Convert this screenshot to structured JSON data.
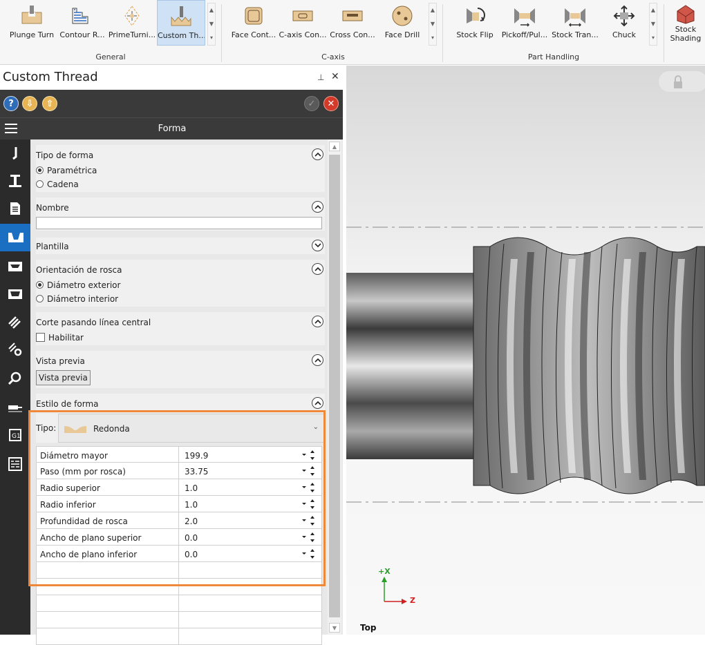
{
  "ribbon": {
    "groups": [
      {
        "label": "General",
        "buttons": [
          {
            "label": "Plunge Turn",
            "icon": "plunge-turn-icon"
          },
          {
            "label": "Contour R...",
            "icon": "contour-rough-icon"
          },
          {
            "label": "PrimeTurni...",
            "icon": "primeturning-icon"
          },
          {
            "label": "Custom Th...",
            "icon": "custom-thread-icon",
            "selected": true
          }
        ]
      },
      {
        "label": "C-axis",
        "buttons": [
          {
            "label": "Face Cont...",
            "icon": "face-contour-icon"
          },
          {
            "label": "C-axis Con...",
            "icon": "c-axis-contour-icon"
          },
          {
            "label": "Cross Con...",
            "icon": "cross-contour-icon"
          },
          {
            "label": "Face Drill",
            "icon": "face-drill-icon"
          }
        ]
      },
      {
        "label": "Part Handling",
        "buttons": [
          {
            "label": "Stock Flip",
            "icon": "stock-flip-icon"
          },
          {
            "label": "Pickoff/Pul...",
            "icon": "pickoff-pull-icon"
          },
          {
            "label": "Stock Tran...",
            "icon": "stock-transfer-icon"
          },
          {
            "label": "Chuck",
            "icon": "chuck-icon"
          }
        ]
      }
    ],
    "extra": {
      "label_line1": "Stock",
      "label_line2": "Shading"
    }
  },
  "panel": {
    "title": "Custom Thread",
    "header": "Forma",
    "sections": {
      "tipo_forma": {
        "title": "Tipo de forma",
        "options": [
          "Paramétrica",
          "Cadena"
        ],
        "selected": 0
      },
      "nombre": {
        "title": "Nombre",
        "value": ""
      },
      "plantilla": {
        "title": "Plantilla"
      },
      "orientacion": {
        "title": "Orientación de rosca",
        "options": [
          "Diámetro exterior",
          "Diámetro interior"
        ],
        "selected": 0
      },
      "corte": {
        "title": "Corte pasando línea central",
        "checkbox_label": "Habilitar",
        "checked": false
      },
      "vista": {
        "title": "Vista previa",
        "button_label": "Vista previa"
      },
      "estilo": {
        "title": "Estilo de forma"
      }
    },
    "tipo": {
      "label": "Tipo:",
      "value": "Redonda"
    },
    "params": [
      {
        "name": "Diámetro mayor",
        "value": "199.9"
      },
      {
        "name": "Paso (mm por rosca)",
        "value": "33.75"
      },
      {
        "name": "Radio superior",
        "value": "1.0"
      },
      {
        "name": "Radio inferior",
        "value": "1.0"
      },
      {
        "name": "Profundidad de rosca",
        "value": "2.0"
      },
      {
        "name": "Ancho de plano superior",
        "value": "0.0"
      },
      {
        "name": "Ancho de plano inferior",
        "value": "0.0"
      }
    ]
  },
  "viewport": {
    "axis_x": "+X",
    "axis_z": "Z",
    "view_name": "Top"
  },
  "colors": {
    "accent": "#1a6fc2",
    "highlight": "#f0883a",
    "dark": "#3a3a3a"
  }
}
